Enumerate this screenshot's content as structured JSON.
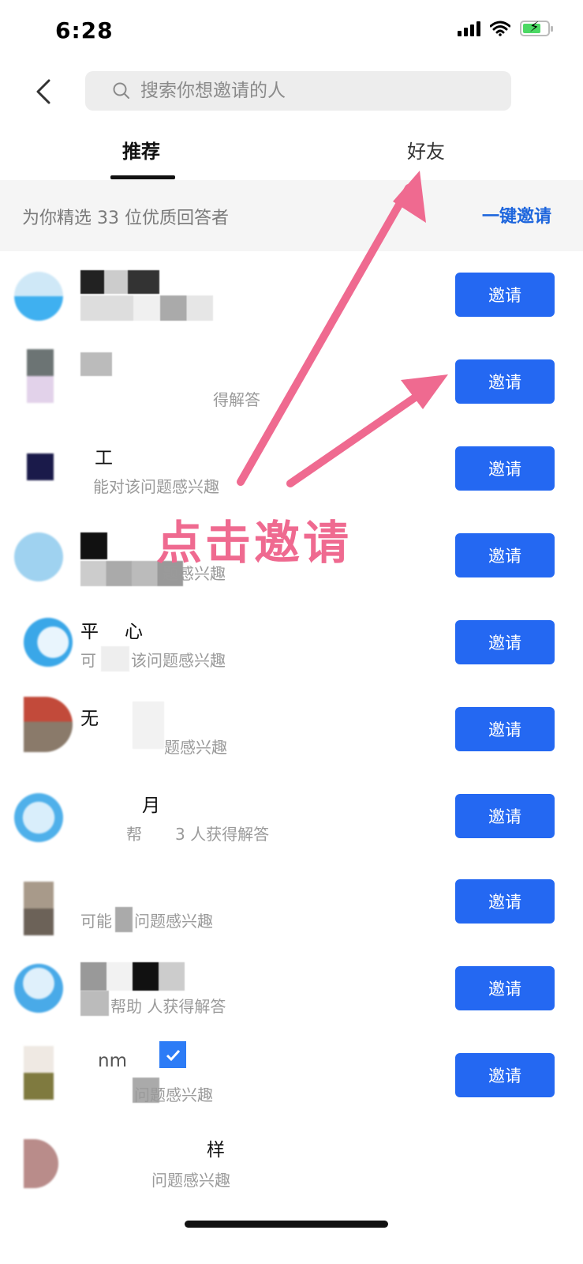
{
  "status_bar": {
    "time": "6:28"
  },
  "search": {
    "placeholder": "搜索你想邀请的人"
  },
  "tabs": [
    {
      "label": "推荐",
      "active": true
    },
    {
      "label": "好友",
      "active": false
    }
  ],
  "banner": {
    "text": "为你精选 33 位优质回答者",
    "invite_all_label": "一键邀请"
  },
  "list": [
    {
      "name": "",
      "desc": "",
      "button": "邀请"
    },
    {
      "name": "",
      "desc": "得解答",
      "button": "邀请"
    },
    {
      "name": "工",
      "desc": "能对该问题感兴趣",
      "button": "邀请"
    },
    {
      "name": "",
      "desc": "题感兴趣",
      "button": "邀请"
    },
    {
      "name": "心",
      "desc": "该问题感兴趣",
      "button": "邀请"
    },
    {
      "name": "无",
      "desc": "题感兴趣",
      "button": "邀请"
    },
    {
      "name": "月",
      "desc": "3 人获得解答",
      "button": "邀请"
    },
    {
      "name": "",
      "desc": "问题感兴趣",
      "button": "邀请"
    },
    {
      "name": "",
      "desc": "帮助 人获得解答",
      "button": "邀请"
    },
    {
      "name": "nm",
      "desc": "问题感兴趣",
      "button": "邀请"
    },
    {
      "name": "样",
      "desc": "问题感兴趣"
    }
  ],
  "annotation": {
    "text": "点击邀请"
  },
  "colors": {
    "accent": "#2468f2",
    "annotation": "#ef6a90",
    "link": "#1e66dd"
  }
}
